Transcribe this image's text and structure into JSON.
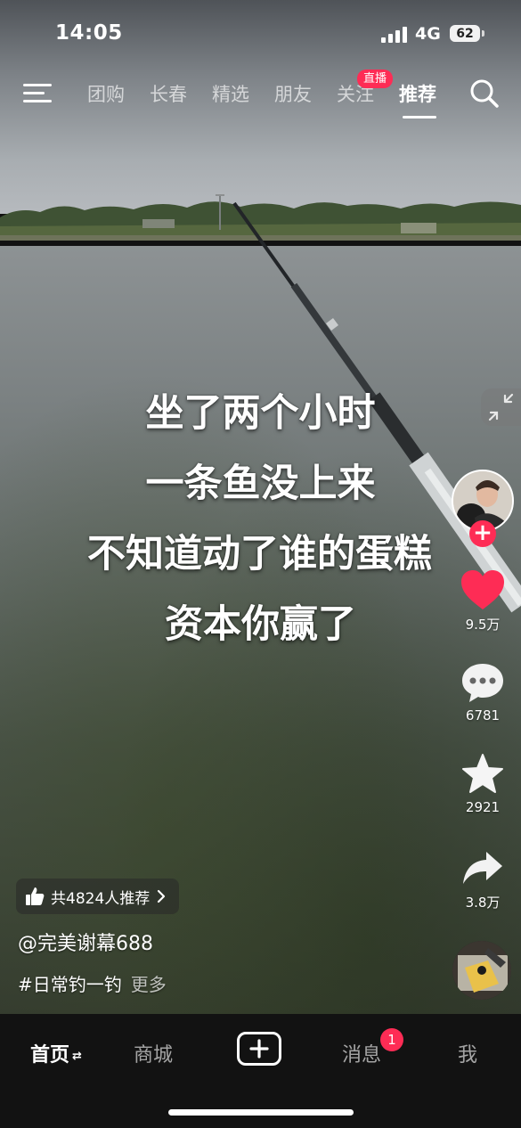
{
  "status_bar": {
    "time": "14:05",
    "network": "4G",
    "battery": "62"
  },
  "top_nav": {
    "tabs": [
      {
        "label": "团购"
      },
      {
        "label": "长春"
      },
      {
        "label": "精选"
      },
      {
        "label": "朋友"
      },
      {
        "label": "关注"
      },
      {
        "label": "推荐"
      }
    ],
    "active_tab": "推荐",
    "live_badge": "直播"
  },
  "caption": {
    "lines": [
      "坐了两个小时",
      "一条鱼没上来",
      "不知道动了谁的蛋糕",
      "资本你赢了"
    ]
  },
  "actions": {
    "likes": "9.5万",
    "comments": "6781",
    "favorites": "2921",
    "shares": "3.8万"
  },
  "video_info": {
    "recommend_text": "共4824人推荐",
    "author": "@完美谢幕688",
    "hashtag": "#日常钓一钓",
    "more_label": "更多"
  },
  "bottom_bar": {
    "tabs": [
      {
        "label": "首页"
      },
      {
        "label": "商城"
      },
      {
        "label": "消息"
      },
      {
        "label": "我"
      }
    ],
    "home_switch_glyph": "⇄",
    "message_badge": "1"
  },
  "colors": {
    "accent": "#fe2c55",
    "bar_bg": "#121212"
  },
  "icons": [
    "menu-icon",
    "search-icon",
    "shrink-icon",
    "heart-icon",
    "comment-icon",
    "star-icon",
    "share-icon",
    "thumbs-up-icon",
    "chevron-right-icon",
    "plus-icon"
  ]
}
